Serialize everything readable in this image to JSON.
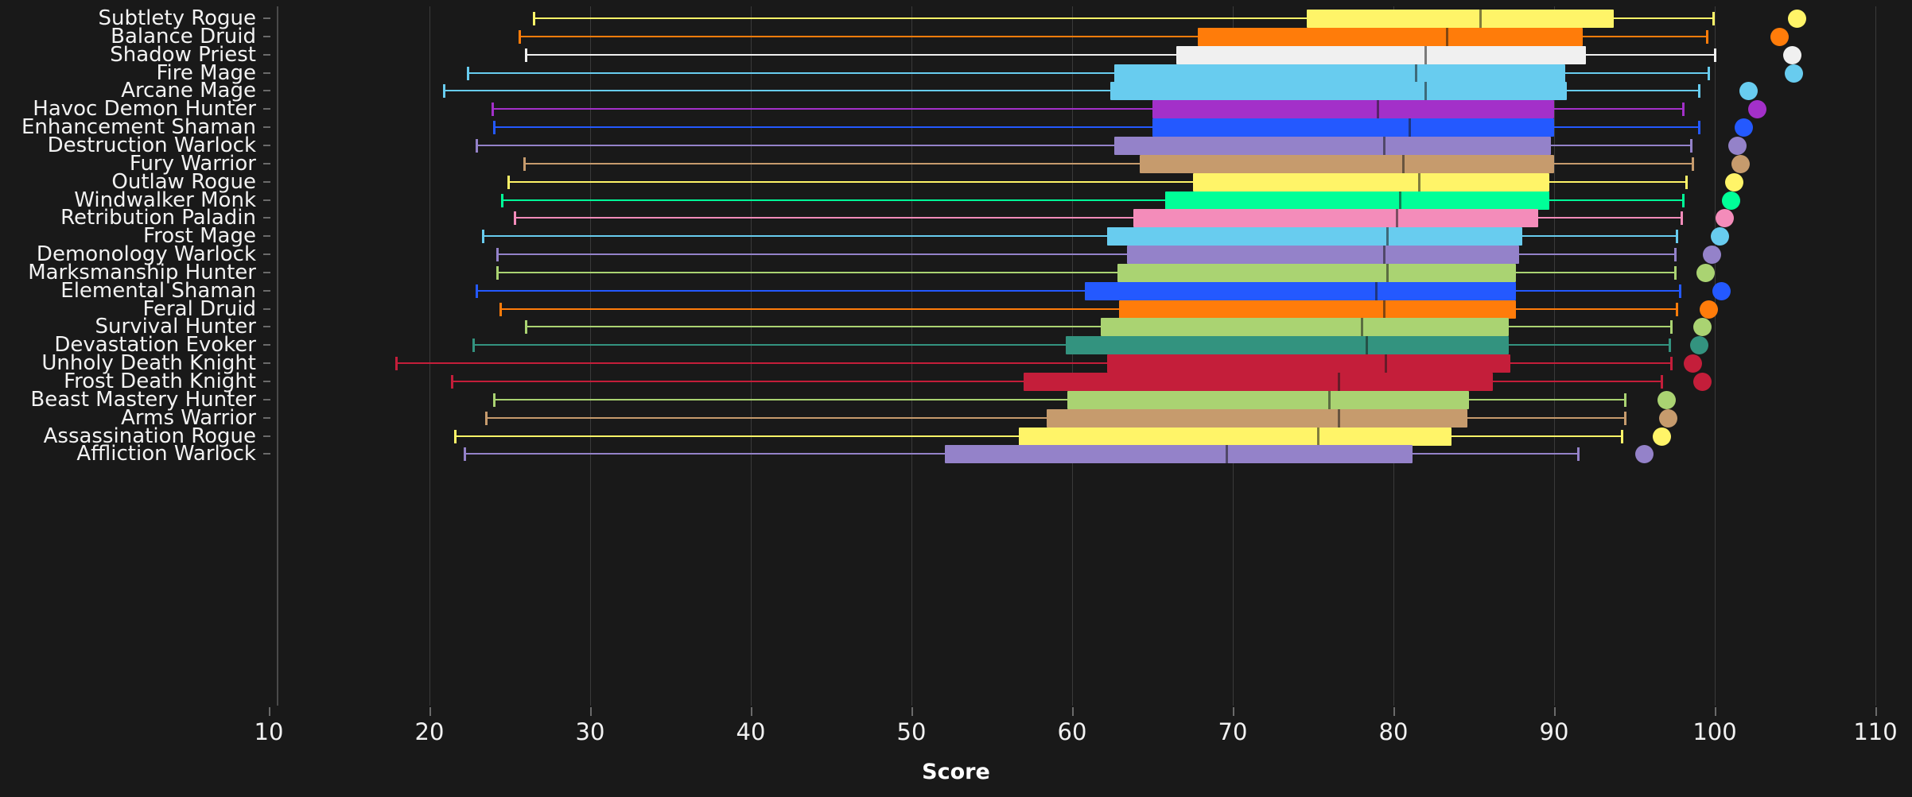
{
  "chart_data": {
    "type": "box",
    "title": "",
    "xlabel": "Score",
    "ylabel": "",
    "xlim": [
      10,
      110
    ],
    "xticks": [
      10,
      20,
      30,
      40,
      50,
      60,
      70,
      80,
      90,
      100,
      110
    ],
    "xticklabels": [
      "10",
      "20",
      "30",
      "40",
      "50",
      "60",
      "70",
      "80",
      "90",
      "100",
      "110"
    ],
    "grid": true,
    "background": "#191919",
    "categories": [
      "Subtlety Rogue",
      "Balance Druid",
      "Shadow Priest",
      "Fire Mage",
      "Arcane Mage",
      "Havoc Demon Hunter",
      "Enhancement Shaman",
      "Destruction Warlock",
      "Fury Warrior",
      "Outlaw Rogue",
      "Windwalker Monk",
      "Retribution Paladin",
      "Frost Mage",
      "Demonology Warlock",
      "Marksmanship Hunter",
      "Elemental Shaman",
      "Feral Druid",
      "Survival Hunter",
      "Devastation Evoker",
      "Unholy Death Knight",
      "Frost Death Knight",
      "Beast Mastery Hunter",
      "Arms Warrior",
      "Assassination Rogue",
      "Affliction Warlock"
    ],
    "boxes": [
      {
        "label": "Subtlety Rogue",
        "color": "#fff468",
        "whisker_low": 26.5,
        "q1": 74.6,
        "median": 85.4,
        "q3": 93.7,
        "whisker_high": 99.9,
        "outliers": [
          105.1
        ]
      },
      {
        "label": "Balance Druid",
        "color": "#ff7c0a",
        "whisker_low": 25.6,
        "q1": 67.8,
        "median": 83.3,
        "q3": 91.8,
        "whisker_high": 99.5,
        "outliers": [
          104.0
        ]
      },
      {
        "label": "Shadow Priest",
        "color": "#f0f0f0",
        "whisker_low": 26.0,
        "q1": 66.5,
        "median": 82.0,
        "q3": 92.0,
        "whisker_high": 100.0,
        "outliers": [
          104.8
        ]
      },
      {
        "label": "Fire Mage",
        "color": "#68ccef",
        "whisker_low": 22.4,
        "q1": 62.6,
        "median": 81.4,
        "q3": 90.7,
        "whisker_high": 99.6,
        "outliers": [
          104.9
        ]
      },
      {
        "label": "Arcane Mage",
        "color": "#68ccef",
        "whisker_low": 20.9,
        "q1": 62.4,
        "median": 82.0,
        "q3": 90.8,
        "whisker_high": 99.0,
        "outliers": [
          102.1
        ]
      },
      {
        "label": "Havoc Demon Hunter",
        "color": "#a330c9",
        "whisker_low": 23.9,
        "q1": 65.0,
        "median": 79.0,
        "q3": 90.0,
        "whisker_high": 98.0,
        "outliers": [
          102.6
        ]
      },
      {
        "label": "Enhancement Shaman",
        "color": "#2459ff",
        "whisker_low": 24.0,
        "q1": 65.0,
        "median": 81.0,
        "q3": 90.0,
        "whisker_high": 99.0,
        "outliers": [
          101.8
        ]
      },
      {
        "label": "Destruction Warlock",
        "color": "#9482c9",
        "whisker_low": 22.9,
        "q1": 62.6,
        "median": 79.4,
        "q3": 89.8,
        "whisker_high": 98.5,
        "outliers": [
          101.4
        ]
      },
      {
        "label": "Fury Warrior",
        "color": "#c69b6d",
        "whisker_low": 25.9,
        "q1": 64.2,
        "median": 80.6,
        "q3": 90.0,
        "whisker_high": 98.6,
        "outliers": [
          101.6
        ]
      },
      {
        "label": "Outlaw Rogue",
        "color": "#fff468",
        "whisker_low": 24.9,
        "q1": 67.5,
        "median": 81.6,
        "q3": 89.7,
        "whisker_high": 98.2,
        "outliers": [
          101.2
        ]
      },
      {
        "label": "Windwalker Monk",
        "color": "#00ff98",
        "whisker_low": 24.5,
        "q1": 65.8,
        "median": 80.4,
        "q3": 89.7,
        "whisker_high": 98.0,
        "outliers": [
          101.0
        ]
      },
      {
        "label": "Retribution Paladin",
        "color": "#f48cba",
        "whisker_low": 25.3,
        "q1": 63.8,
        "median": 80.2,
        "q3": 89.0,
        "whisker_high": 97.9,
        "outliers": [
          100.6
        ]
      },
      {
        "label": "Frost Mage",
        "color": "#68ccef",
        "whisker_low": 23.3,
        "q1": 62.2,
        "median": 79.6,
        "q3": 88.0,
        "whisker_high": 97.6,
        "outliers": [
          100.3
        ]
      },
      {
        "label": "Demonology Warlock",
        "color": "#9482c9",
        "whisker_low": 24.2,
        "q1": 63.4,
        "median": 79.4,
        "q3": 87.8,
        "whisker_high": 97.5,
        "outliers": [
          99.8
        ]
      },
      {
        "label": "Marksmanship Hunter",
        "color": "#aad372",
        "whisker_low": 24.2,
        "q1": 62.8,
        "median": 79.6,
        "q3": 87.6,
        "whisker_high": 97.5,
        "outliers": [
          99.4
        ]
      },
      {
        "label": "Elemental Shaman",
        "color": "#2459ff",
        "whisker_low": 22.9,
        "q1": 60.8,
        "median": 78.9,
        "q3": 87.6,
        "whisker_high": 97.8,
        "outliers": [
          100.4
        ]
      },
      {
        "label": "Feral Druid",
        "color": "#ff7c0a",
        "whisker_low": 24.4,
        "q1": 62.9,
        "median": 79.4,
        "q3": 87.6,
        "whisker_high": 97.6,
        "outliers": [
          99.6
        ]
      },
      {
        "label": "Survival Hunter",
        "color": "#aad372",
        "whisker_low": 26.0,
        "q1": 61.8,
        "median": 78.0,
        "q3": 87.2,
        "whisker_high": 97.3,
        "outliers": [
          99.2
        ]
      },
      {
        "label": "Devastation Evoker",
        "color": "#33937f",
        "whisker_low": 22.7,
        "q1": 59.6,
        "median": 78.3,
        "q3": 87.2,
        "whisker_high": 97.2,
        "outliers": [
          99.0
        ]
      },
      {
        "label": "Unholy Death Knight",
        "color": "#c41e3a",
        "whisker_low": 17.9,
        "q1": 62.2,
        "median": 79.5,
        "q3": 87.3,
        "whisker_high": 97.3,
        "outliers": [
          98.6
        ]
      },
      {
        "label": "Frost Death Knight",
        "color": "#c41e3a",
        "whisker_low": 21.4,
        "q1": 57.0,
        "median": 76.6,
        "q3": 86.2,
        "whisker_high": 96.7,
        "outliers": [
          99.2
        ]
      },
      {
        "label": "Beast Mastery Hunter",
        "color": "#aad372",
        "whisker_low": 24.0,
        "q1": 59.7,
        "median": 76.0,
        "q3": 84.7,
        "whisker_high": 94.4,
        "outliers": [
          97.0
        ]
      },
      {
        "label": "Arms Warrior",
        "color": "#c69b6d",
        "whisker_low": 23.5,
        "q1": 58.4,
        "median": 76.6,
        "q3": 84.6,
        "whisker_high": 94.4,
        "outliers": [
          97.1
        ]
      },
      {
        "label": "Assassination Rogue",
        "color": "#fff468",
        "whisker_low": 21.6,
        "q1": 56.7,
        "median": 75.3,
        "q3": 83.6,
        "whisker_high": 94.2,
        "outliers": [
          96.7
        ]
      },
      {
        "label": "Affliction Warlock",
        "color": "#9482c9",
        "whisker_low": 22.2,
        "q1": 52.1,
        "median": 69.6,
        "q3": 81.2,
        "whisker_high": 91.5,
        "outliers": [
          95.6
        ]
      }
    ]
  }
}
